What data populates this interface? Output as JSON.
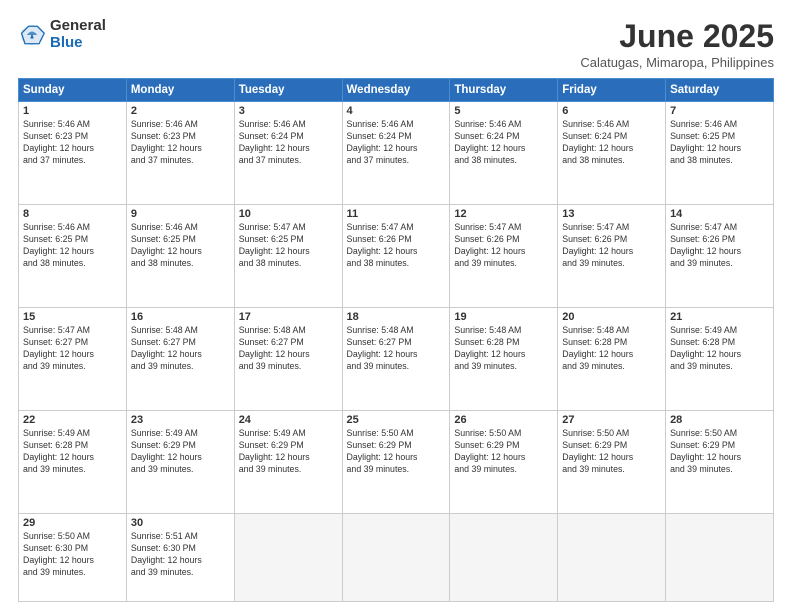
{
  "logo": {
    "general": "General",
    "blue": "Blue"
  },
  "title": "June 2025",
  "location": "Calatugas, Mimaropa, Philippines",
  "headers": [
    "Sunday",
    "Monday",
    "Tuesday",
    "Wednesday",
    "Thursday",
    "Friday",
    "Saturday"
  ],
  "weeks": [
    [
      {
        "day": "1",
        "sunrise": "5:46 AM",
        "sunset": "6:23 PM",
        "daylight": "12 hours and 37 minutes."
      },
      {
        "day": "2",
        "sunrise": "5:46 AM",
        "sunset": "6:23 PM",
        "daylight": "12 hours and 37 minutes."
      },
      {
        "day": "3",
        "sunrise": "5:46 AM",
        "sunset": "6:24 PM",
        "daylight": "12 hours and 37 minutes."
      },
      {
        "day": "4",
        "sunrise": "5:46 AM",
        "sunset": "6:24 PM",
        "daylight": "12 hours and 37 minutes."
      },
      {
        "day": "5",
        "sunrise": "5:46 AM",
        "sunset": "6:24 PM",
        "daylight": "12 hours and 38 minutes."
      },
      {
        "day": "6",
        "sunrise": "5:46 AM",
        "sunset": "6:24 PM",
        "daylight": "12 hours and 38 minutes."
      },
      {
        "day": "7",
        "sunrise": "5:46 AM",
        "sunset": "6:25 PM",
        "daylight": "12 hours and 38 minutes."
      }
    ],
    [
      {
        "day": "8",
        "sunrise": "5:46 AM",
        "sunset": "6:25 PM",
        "daylight": "12 hours and 38 minutes."
      },
      {
        "day": "9",
        "sunrise": "5:46 AM",
        "sunset": "6:25 PM",
        "daylight": "12 hours and 38 minutes."
      },
      {
        "day": "10",
        "sunrise": "5:47 AM",
        "sunset": "6:25 PM",
        "daylight": "12 hours and 38 minutes."
      },
      {
        "day": "11",
        "sunrise": "5:47 AM",
        "sunset": "6:26 PM",
        "daylight": "12 hours and 38 minutes."
      },
      {
        "day": "12",
        "sunrise": "5:47 AM",
        "sunset": "6:26 PM",
        "daylight": "12 hours and 39 minutes."
      },
      {
        "day": "13",
        "sunrise": "5:47 AM",
        "sunset": "6:26 PM",
        "daylight": "12 hours and 39 minutes."
      },
      {
        "day": "14",
        "sunrise": "5:47 AM",
        "sunset": "6:26 PM",
        "daylight": "12 hours and 39 minutes."
      }
    ],
    [
      {
        "day": "15",
        "sunrise": "5:47 AM",
        "sunset": "6:27 PM",
        "daylight": "12 hours and 39 minutes."
      },
      {
        "day": "16",
        "sunrise": "5:48 AM",
        "sunset": "6:27 PM",
        "daylight": "12 hours and 39 minutes."
      },
      {
        "day": "17",
        "sunrise": "5:48 AM",
        "sunset": "6:27 PM",
        "daylight": "12 hours and 39 minutes."
      },
      {
        "day": "18",
        "sunrise": "5:48 AM",
        "sunset": "6:27 PM",
        "daylight": "12 hours and 39 minutes."
      },
      {
        "day": "19",
        "sunrise": "5:48 AM",
        "sunset": "6:28 PM",
        "daylight": "12 hours and 39 minutes."
      },
      {
        "day": "20",
        "sunrise": "5:48 AM",
        "sunset": "6:28 PM",
        "daylight": "12 hours and 39 minutes."
      },
      {
        "day": "21",
        "sunrise": "5:49 AM",
        "sunset": "6:28 PM",
        "daylight": "12 hours and 39 minutes."
      }
    ],
    [
      {
        "day": "22",
        "sunrise": "5:49 AM",
        "sunset": "6:28 PM",
        "daylight": "12 hours and 39 minutes."
      },
      {
        "day": "23",
        "sunrise": "5:49 AM",
        "sunset": "6:29 PM",
        "daylight": "12 hours and 39 minutes."
      },
      {
        "day": "24",
        "sunrise": "5:49 AM",
        "sunset": "6:29 PM",
        "daylight": "12 hours and 39 minutes."
      },
      {
        "day": "25",
        "sunrise": "5:50 AM",
        "sunset": "6:29 PM",
        "daylight": "12 hours and 39 minutes."
      },
      {
        "day": "26",
        "sunrise": "5:50 AM",
        "sunset": "6:29 PM",
        "daylight": "12 hours and 39 minutes."
      },
      {
        "day": "27",
        "sunrise": "5:50 AM",
        "sunset": "6:29 PM",
        "daylight": "12 hours and 39 minutes."
      },
      {
        "day": "28",
        "sunrise": "5:50 AM",
        "sunset": "6:29 PM",
        "daylight": "12 hours and 39 minutes."
      }
    ],
    [
      {
        "day": "29",
        "sunrise": "5:50 AM",
        "sunset": "6:30 PM",
        "daylight": "12 hours and 39 minutes."
      },
      {
        "day": "30",
        "sunrise": "5:51 AM",
        "sunset": "6:30 PM",
        "daylight": "12 hours and 39 minutes."
      },
      null,
      null,
      null,
      null,
      null
    ]
  ],
  "labels": {
    "sunrise": "Sunrise:",
    "sunset": "Sunset:",
    "daylight": "Daylight:"
  }
}
